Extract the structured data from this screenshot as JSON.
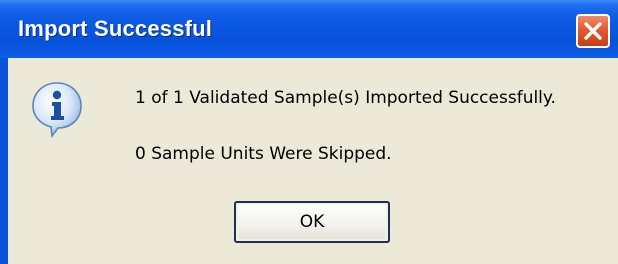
{
  "dialog": {
    "title": "Import Successful",
    "message_line_1": "1 of 1 Validated Sample(s) Imported Successfully.",
    "message_line_2": "0 Sample Units Were Skipped.",
    "ok_label": "OK",
    "icon": "information-icon",
    "close_icon": "close-icon"
  },
  "colors": {
    "titlebar": "#0852db",
    "client_background": "#ece9d8",
    "close_button": "#e25a30",
    "title_text": "#ffffff"
  }
}
